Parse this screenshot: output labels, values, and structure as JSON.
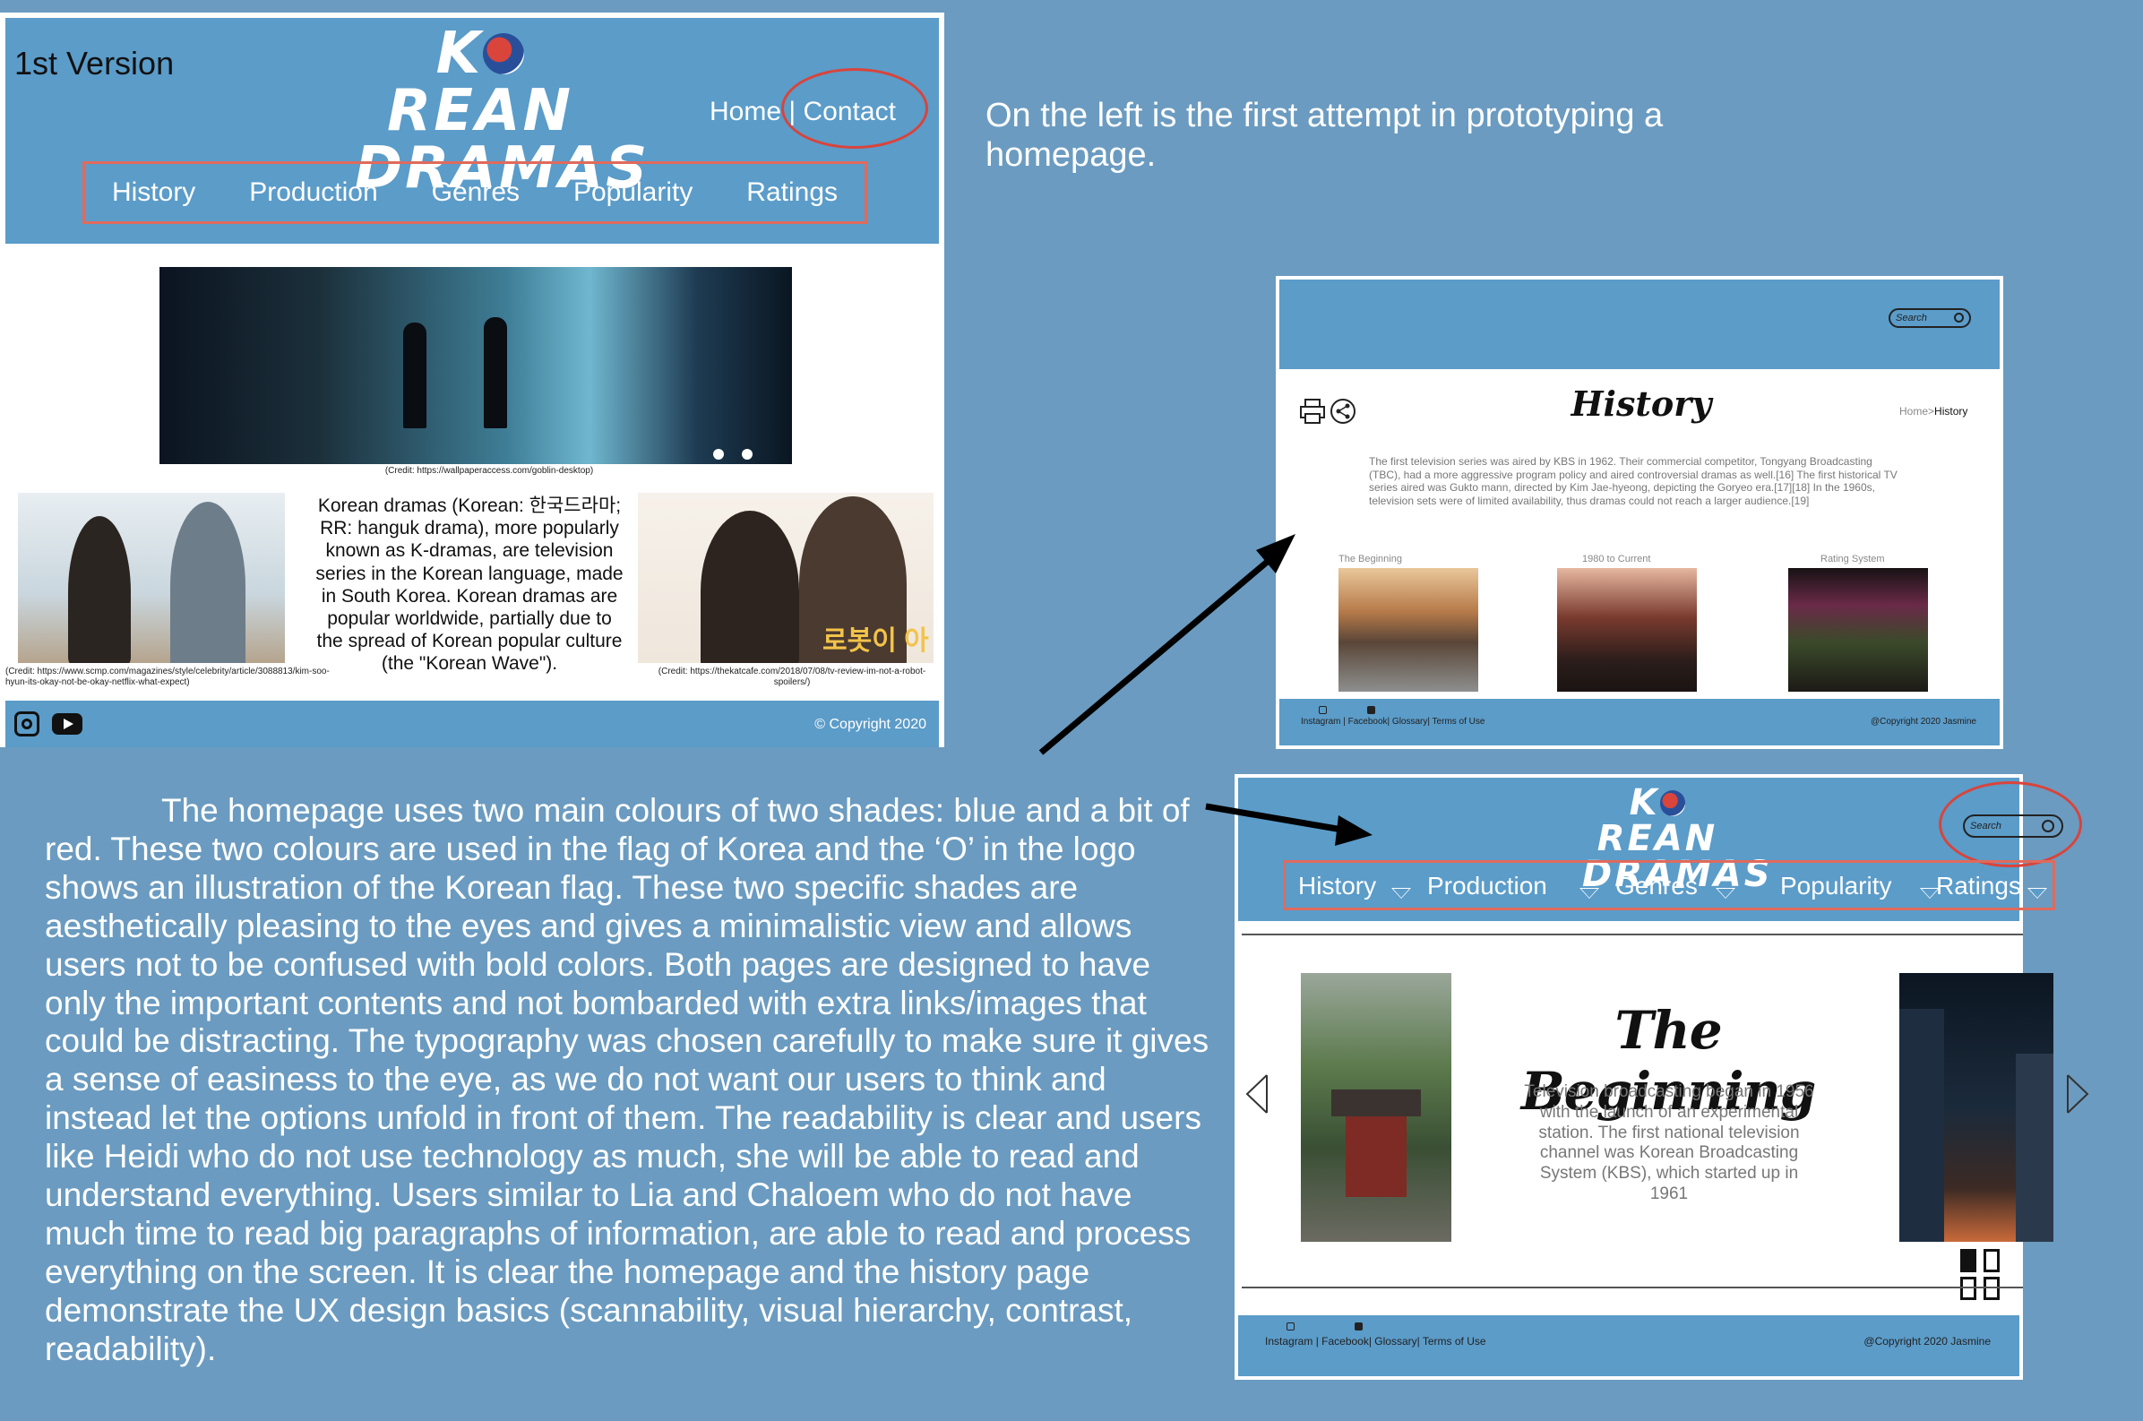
{
  "colors": {
    "background": "#6b9bc0",
    "header_blue": "#5b9cc9",
    "accent_red": "#d9443b",
    "nav_border": "#e06a5c"
  },
  "version1": {
    "label": "1st Version",
    "logo_line1_pre": "K",
    "logo_line1_post": "REAN",
    "logo_line2": "DRAMAS",
    "top_links": {
      "home": "Home",
      "separator": "|",
      "contact": "Contact"
    },
    "nav": [
      "History",
      "Production",
      "Genres",
      "Popularity",
      "Ratings"
    ],
    "hero_credit": "(Credit: https://wallpaperaccess.com/goblin-desktop)",
    "body_text": "Korean dramas (Korean: 한국드라마; RR: hanguk drama), more popularly known as K-dramas, are television series in the Korean language, made in South Korea. Korean dramas are popular worldwide, partially due to the spread of Korean popular culture (the \"Korean Wave\").",
    "left_credit": "(Credit: https://www.scmp.com/magazines/style/celebrity/article/3088813/kim-soo-hyun-its-okay-not-be-okay-netflix-what-expect)",
    "right_credit": "(Credit: https://thekatcafe.com/2018/07/08/tv-review-im-not-a-robot-spoilers/)",
    "right_poster_text": "로봇이 아니야",
    "copyright": "© Copyright 2020",
    "icons": [
      "instagram-icon",
      "youtube-icon"
    ]
  },
  "top_description": "On the left is the first attempt in prototyping a homepage.",
  "history_page": {
    "search_placeholder": "Search",
    "title": "History",
    "breadcrumb_home": "Home",
    "breadcrumb_sep": ">",
    "breadcrumb_current": "History",
    "paragraph": "The first television series was aired by KBS in 1962. Their commercial competitor, Tongyang Broadcasting (TBC), had a more aggressive program policy and aired controversial dramas as well.[16] The first historical TV series aired was Gukto mann, directed by Kim Jae-hyeong, depicting the Goryeo era.[17][18] In the 1960s, television sets were of limited availability, thus dramas could not reach a larger audience.[19]",
    "sections": [
      {
        "caption": "The Beginning"
      },
      {
        "caption": "1980 to Current"
      },
      {
        "caption": "Rating System"
      }
    ],
    "footer_links": "Instagram | Facebook| Glossary| Terms of Use",
    "copyright": "@Copyright 2020 Jasmine",
    "icons": [
      "print-icon",
      "share-icon",
      "instagram-icon",
      "facebook-icon"
    ]
  },
  "version2": {
    "logo_line1_pre": "K",
    "logo_line1_post": "REAN",
    "logo_line2": "DRAMAS",
    "search_placeholder": "Search",
    "nav": [
      "History",
      "Production",
      "Genres",
      "Popularity",
      "Ratings"
    ],
    "slide_heading": "The Beginning",
    "slide_text": "Television broadcasting began in 1956 with the launch of an experimental station. The first national television channel was Korean Broadcasting System (KBS), which started up in 1961",
    "pager": {
      "total": 4,
      "current": 1
    },
    "footer_links": "Instagram | Facebook| Glossary| Terms of Use",
    "copyright": "@Copyright 2020 Jasmine",
    "icons": [
      "chevron-left-icon",
      "chevron-right-icon",
      "instagram-icon",
      "facebook-icon",
      "search-icon"
    ]
  },
  "main_description": "The homepage uses two main colours of two shades: blue and a bit of red. These two colours are used in the flag of Korea and the ‘O’ in the logo shows an illustration of the Korean flag. These two specific shades are aesthetically pleasing to the eyes and gives a minimalistic view and allows users not to be confused with bold colors. Both pages are designed to have only the important contents and not bombarded with extra links/images that could be distracting. The typography was chosen carefully to make sure it gives a sense of easiness to the eye, as we do not want our users to think and instead let the options unfold in front of them. The readability is clear and users like Heidi who do not use technology as much, she will be able to read and understand everything. Users similar to Lia and Chaloem who do not have much time to read big paragraphs of information, are able to read and process everything on the screen. It is clear the homepage and the history page demonstrate the UX design basics (scannability, visual hierarchy, contrast, readability)."
}
